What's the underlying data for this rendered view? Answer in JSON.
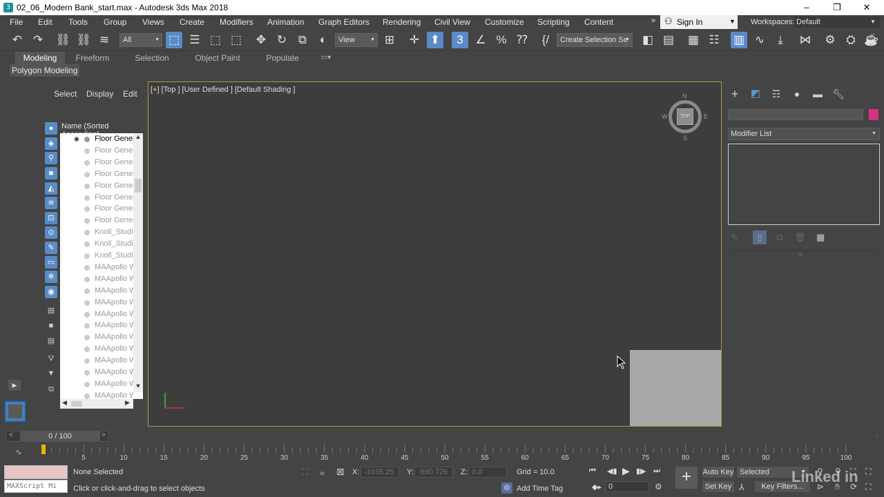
{
  "window": {
    "title": "02_06_Modern Bank_start.max - Autodesk 3ds Max 2018",
    "minimize": "–",
    "restore": "❐",
    "close": "✕"
  },
  "menu": {
    "items": [
      "File",
      "Edit",
      "Tools",
      "Group",
      "Views",
      "Create",
      "Modifiers",
      "Animation",
      "Graph Editors",
      "Rendering",
      "Civil View",
      "Customize",
      "Scripting",
      "Content"
    ],
    "signin_label": "Sign In",
    "workspaces_label": "Workspaces:",
    "workspace_value": "Default"
  },
  "toolbar": {
    "filter_value": "All",
    "refcoord_value": "View",
    "selection_set_value": "Create Selection Se"
  },
  "ribbon": {
    "tabs": [
      "Modeling",
      "Freeform",
      "Selection",
      "Object Paint",
      "Populate"
    ],
    "sub_label": "Polygon Modeling"
  },
  "explorer": {
    "tabs": [
      "Select",
      "Display",
      "Edit"
    ],
    "column_header": "Name (Sorted Ascending)",
    "items": [
      "Floor Generi",
      "Floor Generi",
      "Floor Generi",
      "Floor Generi",
      "Floor Generi",
      "Floor Generi",
      "Floor Generi",
      "Floor Generi",
      "Knoll_Studio",
      "Knoll_Studio",
      "Knoll_Studio",
      "MAApollo W",
      "MAApollo W",
      "MAApollo W",
      "MAApollo W",
      "MAApollo W",
      "MAApollo W",
      "MAApollo W",
      "MAApollo W",
      "MAApollo W",
      "MAApollo W",
      "MAApollo W",
      "MAApollo W"
    ]
  },
  "viewport": {
    "label": "[+] [Top ] [User Defined ] [Default Shading ]",
    "viewcube_face": "TOP",
    "compass": {
      "n": "N",
      "s": "S",
      "e": "E",
      "w": "W"
    }
  },
  "command_panel": {
    "modifier_list_label": "Modifier List",
    "color_swatch": "#d63384"
  },
  "timeline": {
    "frame_display": "0 / 100",
    "ticks": [
      "5",
      "10",
      "15",
      "20",
      "25",
      "30",
      "35",
      "40",
      "45",
      "50",
      "55",
      "60",
      "65",
      "70",
      "75",
      "80",
      "85",
      "90",
      "95",
      "100"
    ]
  },
  "status": {
    "maxscript_placeholder": "MAXScript Mi",
    "selection_text": "None Selected",
    "prompt_text": "Click or click-and-drag to select objects",
    "x_label": "X:",
    "x_value": "-1035.25",
    "y_label": "Y:",
    "y_value": "-590.726",
    "z_label": "Z:",
    "z_value": "0.0",
    "grid_text": "Grid = 10.0",
    "add_time_tag": "Add Time Tag",
    "auto_key": "Auto Key",
    "set_key": "Set Key",
    "selected_dropdown": "Selected",
    "key_filters": "Key Filters...",
    "frame_value": "0",
    "watermark": "Linked in"
  }
}
